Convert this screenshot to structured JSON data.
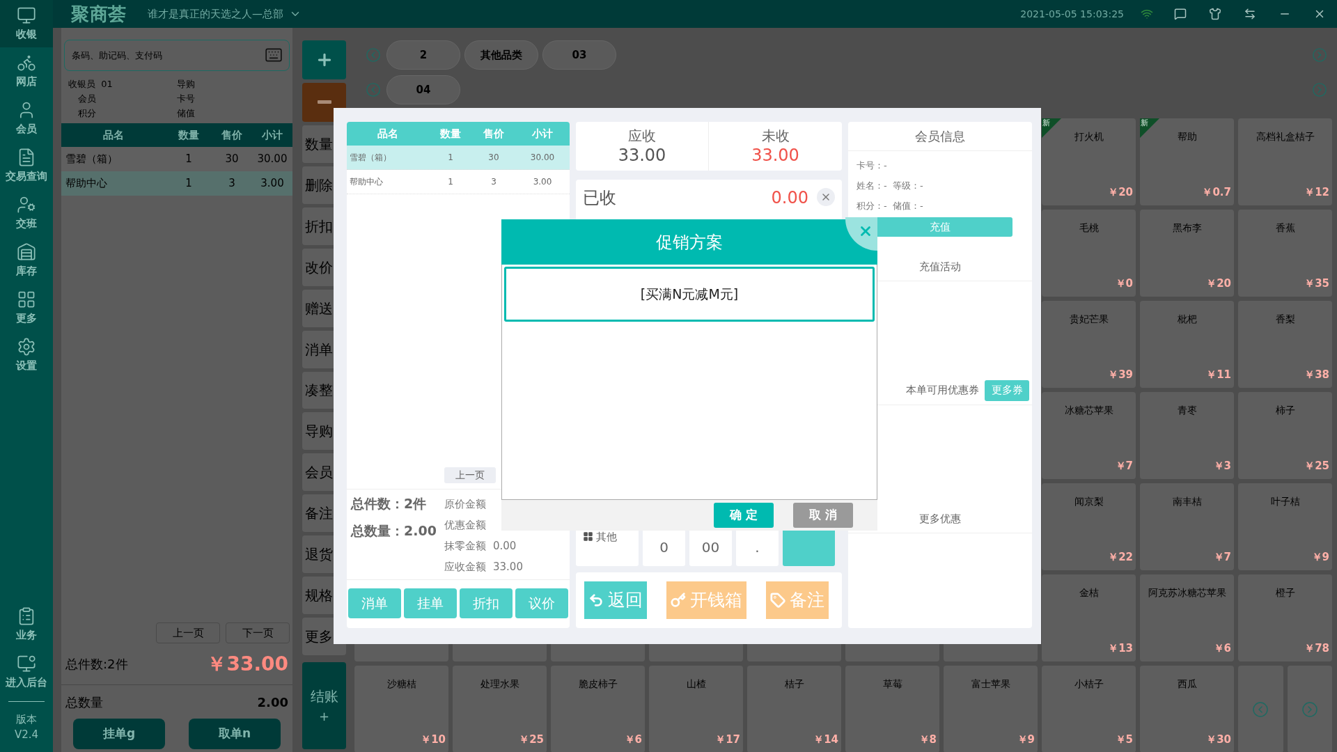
{
  "top_bar": {
    "logo": "聚商荟",
    "store": "谁才是真正的天选之人—总部",
    "datetime": "2021-05-05 15:03:25"
  },
  "sidebar": {
    "items": [
      {
        "label": "收银",
        "selected": true
      },
      {
        "label": "网店",
        "selected": false
      },
      {
        "label": "会员",
        "selected": false
      },
      {
        "label": "交易查询",
        "selected": false
      },
      {
        "label": "交班",
        "selected": false
      },
      {
        "label": "库存",
        "selected": false
      },
      {
        "label": "更多",
        "selected": false
      },
      {
        "label": "设置",
        "selected": false
      }
    ],
    "bottom_items": [
      {
        "label": "业务"
      },
      {
        "label": "进入后台"
      }
    ],
    "version": "版本\nV2.4"
  },
  "cashier": {
    "search": {
      "placeholder": "条码、助记码、支付码"
    },
    "info_rows": [
      {
        "left": "收银员  01",
        "right": "导购"
      },
      {
        "left": "会员",
        "right": "卡号"
      },
      {
        "left": "积分",
        "right": "储值"
      }
    ],
    "table": {
      "columns": [
        "品名",
        "数量",
        "售价",
        "小计"
      ],
      "rows": [
        {
          "cells": [
            "雪碧（箱）",
            "1",
            "30",
            "30.00"
          ],
          "selected": false
        },
        {
          "cells": [
            "帮助中心",
            "1",
            "3",
            "3.00"
          ],
          "selected": true
        }
      ]
    },
    "pager": [
      "上一页",
      "下一页"
    ],
    "total_items": "总件数:2件",
    "total_amount": "￥33.00",
    "total_qty_label": "总数量",
    "total_qty": "2.00",
    "buttons": [
      "挂单g",
      "取单n"
    ]
  },
  "actions": {
    "buttons": [
      "数量",
      "删除",
      "折扣",
      "改价",
      "赠送",
      "消单",
      "凑整",
      "导购",
      "会员",
      "备注",
      "退货",
      "规格",
      "更多"
    ],
    "checkout": "结账",
    "checkout_sign": "+"
  },
  "categories": [
    {
      "chips": [
        "2",
        "其他品类",
        "03"
      ]
    },
    {
      "chips": [
        "04"
      ]
    }
  ],
  "products": {
    "right_rows": [
      [
        {
          "name": "打火机",
          "price": "￥20",
          "badge": "新"
        },
        {
          "name": "帮助",
          "price": "￥0.7",
          "badge": "新"
        },
        {
          "name": "高档礼盒桔子",
          "price": "￥12"
        }
      ],
      [
        {
          "name": "毛桃",
          "price": "￥0"
        },
        {
          "name": "黑布李",
          "price": "￥20"
        },
        {
          "name": "香蕉",
          "price": "￥35"
        }
      ],
      [
        {
          "name": "贵妃芒果",
          "price": "￥39"
        },
        {
          "name": "枇杷",
          "price": "￥11"
        },
        {
          "name": "香梨",
          "price": "￥38"
        }
      ],
      [
        {
          "name": "冰糖芯苹果",
          "price": "￥7"
        },
        {
          "name": "青枣",
          "price": "￥3"
        },
        {
          "name": "柿子",
          "price": "￥25"
        }
      ],
      [
        {
          "name": "闻京梨",
          "price": "￥22"
        },
        {
          "name": "南丰桔",
          "price": "￥7"
        },
        {
          "name": "叶子桔",
          "price": "￥9"
        }
      ],
      [
        {
          "name": "金桔",
          "price": "￥13"
        },
        {
          "name": "阿克苏冰糖芯苹果",
          "price": "￥6"
        },
        {
          "name": "橙子",
          "price": "￥78"
        }
      ]
    ],
    "last_row": [
      {
        "name": "沙糖桔",
        "price": "￥10"
      },
      {
        "name": "处理水果",
        "price": "￥25"
      },
      {
        "name": "脆皮柿子",
        "price": "￥6"
      },
      {
        "name": "山楂",
        "price": "￥17"
      },
      {
        "name": "桔子",
        "price": "￥14"
      },
      {
        "name": "草莓",
        "price": "￥8"
      },
      {
        "name": "富士苹果",
        "price": "￥9"
      },
      {
        "name": "小桔子",
        "price": "￥5"
      },
      {
        "name": "西瓜",
        "price": "￥30"
      }
    ]
  },
  "checkout_dialog": {
    "table": {
      "columns": [
        "品名",
        "数量",
        "售价",
        "小计"
      ],
      "rows": [
        {
          "cells": [
            "雪碧（箱）",
            "1",
            "30",
            "30.00"
          ],
          "selected": true
        },
        {
          "cells": [
            "帮助中心",
            "1",
            "3",
            "3.00"
          ],
          "selected": false
        }
      ]
    },
    "prev_page": "上一页",
    "totals": [
      {
        "label": "总件数：",
        "value": "2件"
      },
      {
        "label": "总数量：",
        "value": "2.00"
      }
    ],
    "amounts": [
      {
        "label": "原价金额"
      },
      {
        "label": "优惠金额"
      },
      {
        "label": "抹零金额",
        "value": "0.00"
      },
      {
        "label": "应收金额",
        "value": "33.00"
      }
    ],
    "order_buttons": [
      "消单",
      "挂单",
      "折扣",
      "议价"
    ],
    "due": {
      "label": "应收",
      "value": "33.00"
    },
    "unpaid": {
      "label": "未收",
      "value": "33.00"
    },
    "paid": {
      "label": "已收",
      "value": "0.00"
    },
    "keypad": [
      {
        "kind": "other",
        "label": "其他"
      },
      {
        "kind": "key",
        "label": "0"
      },
      {
        "kind": "key",
        "label": "00"
      },
      {
        "kind": "key",
        "label": "."
      },
      {
        "kind": "blank"
      }
    ],
    "actions": [
      {
        "label": "返回",
        "kind": "primary"
      },
      {
        "label": "开钱箱",
        "kind": "secondary"
      },
      {
        "label": "备注",
        "kind": "secondary"
      }
    ],
    "member": {
      "title": "会员信息",
      "lines": [
        "卡号：-",
        "姓名：-  等级：-",
        "积分：-  储值：-"
      ],
      "recharge": "充值",
      "recharge_activity": "充值活动",
      "coupons": "本单可用优惠券",
      "more_coupons": "更多券",
      "more_offers": "更多优惠"
    }
  },
  "promo_dialog": {
    "title": "促销方案",
    "options": [
      {
        "label": "[买满N元减M元]",
        "selected": true
      }
    ],
    "buttons": [
      {
        "label": "确 定",
        "kind": "confirm"
      },
      {
        "label": "取 消",
        "kind": "cancel"
      }
    ]
  }
}
